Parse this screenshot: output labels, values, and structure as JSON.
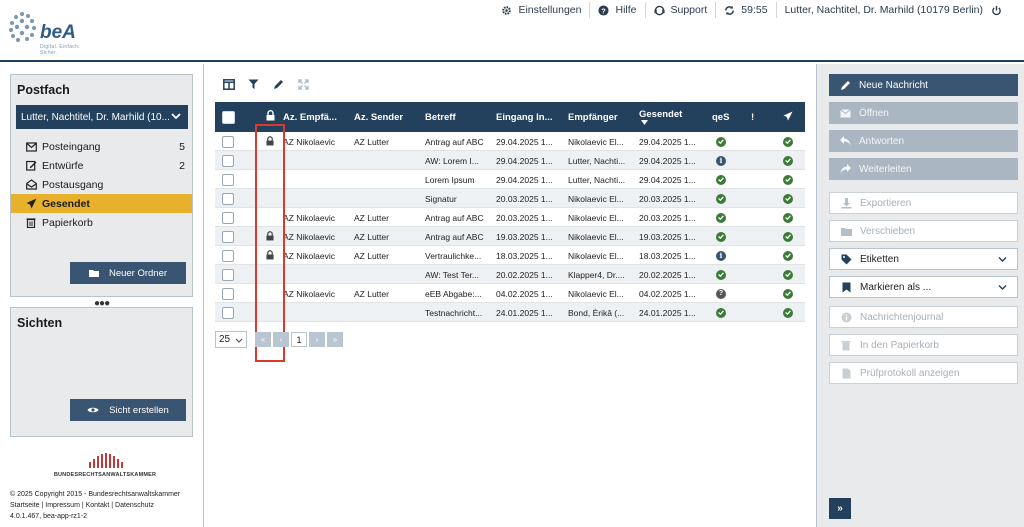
{
  "header": {
    "logo_text": "beA",
    "logo_sub": "Digital. Einfach. Sicher.",
    "settings_label": "Einstellungen",
    "help_label": "Hilfe",
    "support_label": "Support",
    "session_timer": "59:55",
    "user_label": "Lutter, Nachtitel, Dr. Marhild (10179 Berlin)"
  },
  "sidebar": {
    "postfach_title": "Postfach",
    "account": "Lutter, Nachtitel, Dr. Marhild (10...",
    "folders": [
      {
        "label": "Posteingang",
        "count": "5",
        "icon": "inbox-icon"
      },
      {
        "label": "Entwürfe",
        "count": "2",
        "icon": "draft-icon"
      },
      {
        "label": "Postausgang",
        "count": "",
        "icon": "outbox-icon"
      },
      {
        "label": "Gesendet",
        "count": "",
        "icon": "sent-icon"
      },
      {
        "label": "Papierkorb",
        "count": "",
        "icon": "trash-icon"
      }
    ],
    "new_folder_label": "Neuer Ordner",
    "sichten_title": "Sichten",
    "create_view_label": "Sicht erstellen",
    "brak_label": "BUNDESRECHTSANWALTSKAMMER",
    "footer_line1": "© 2025 Copyright 2015 - Bundesrechtsanwaltskammer",
    "footer_line2": "Startseite | Impressum | Kontakt | Datenschutz",
    "footer_line3": "4.0.1.467, bea-app-rz1-2"
  },
  "grid": {
    "columns": {
      "az_empf": "Az. Empfä...",
      "az_sender": "Az. Sender",
      "betreff": "Betreff",
      "eingang": "Eingang In...",
      "empfaenger": "Empfänger",
      "gesendet": "Gesendet",
      "qes": "qeS",
      "flag": "!"
    },
    "rows": [
      {
        "locked": true,
        "az_empf": "AZ Nikolaevic",
        "az_sender": "AZ Lutter",
        "betreff": "Antrag auf ABC",
        "eingang": "29.04.2025 1...",
        "empfaenger": "Nikolaevic El...",
        "gesendet": "29.04.2025 1...",
        "qes": "green"
      },
      {
        "locked": false,
        "az_empf": "",
        "az_sender": "",
        "betreff": "AW: Lorem I...",
        "eingang": "29.04.2025 1...",
        "empfaenger": "Lutter, Nachti...",
        "gesendet": "29.04.2025 1...",
        "qes": "info"
      },
      {
        "locked": false,
        "az_empf": "",
        "az_sender": "",
        "betreff": "Lorem Ipsum",
        "eingang": "29.04.2025 1...",
        "empfaenger": "Lutter, Nachti...",
        "gesendet": "29.04.2025 1...",
        "qes": "green"
      },
      {
        "locked": false,
        "az_empf": "",
        "az_sender": "",
        "betreff": "Signatur",
        "eingang": "20.03.2025 1...",
        "empfaenger": "Nikolaevic El...",
        "gesendet": "20.03.2025 1...",
        "qes": "green"
      },
      {
        "locked": false,
        "az_empf": "AZ Nikolaevic",
        "az_sender": "AZ Lutter",
        "betreff": "Antrag auf ABC",
        "eingang": "20.03.2025 1...",
        "empfaenger": "Nikolaevic El...",
        "gesendet": "20.03.2025 1...",
        "qes": "green"
      },
      {
        "locked": true,
        "az_empf": "AZ Nikolaevic",
        "az_sender": "AZ Lutter",
        "betreff": "Antrag auf ABC",
        "eingang": "19.03.2025 1...",
        "empfaenger": "Nikolaevic El...",
        "gesendet": "19.03.2025 1...",
        "qes": "green"
      },
      {
        "locked": true,
        "az_empf": "AZ Nikolaevic",
        "az_sender": "AZ Lutter",
        "betreff": "Vertraulichke...",
        "eingang": "18.03.2025 1...",
        "empfaenger": "Nikolaevic El...",
        "gesendet": "18.03.2025 1...",
        "qes": "info"
      },
      {
        "locked": false,
        "az_empf": "",
        "az_sender": "",
        "betreff": "AW: Test Ter...",
        "eingang": "20.02.2025 1...",
        "empfaenger": "Klapper4, Dr....",
        "gesendet": "20.02.2025 1...",
        "qes": "green"
      },
      {
        "locked": false,
        "az_empf": "AZ Nikolaevic",
        "az_sender": "AZ Lutter",
        "betreff": "eEB Abgabe:...",
        "eingang": "04.02.2025 1...",
        "empfaenger": "Nikolaevic El...",
        "gesendet": "04.02.2025 1...",
        "qes": "question"
      },
      {
        "locked": false,
        "az_empf": "",
        "az_sender": "",
        "betreff": "Testnachricht...",
        "eingang": "24.01.2025 1...",
        "empfaenger": "Bond, Èrikâ (...",
        "gesendet": "24.01.2025 1...",
        "qes": "green"
      }
    ]
  },
  "pager": {
    "page_size": "25",
    "current_page": "1"
  },
  "actions": {
    "new_message": "Neue Nachricht",
    "open": "Öffnen",
    "reply": "Antworten",
    "forward": "Weiterleiten",
    "export": "Exportieren",
    "move": "Verschieben",
    "labels": "Etiketten",
    "mark_as": "Markieren als ...",
    "journal": "Nachrichtenjournal",
    "to_trash": "In den Papierkorb",
    "protocol": "Prüfprotokoll anzeigen"
  },
  "colors": {
    "navy": "#23405d",
    "button": "#3a5571",
    "active_folder": "#e8b12b",
    "highlight": "#d93a2c",
    "status_green": "#3c7a37"
  }
}
